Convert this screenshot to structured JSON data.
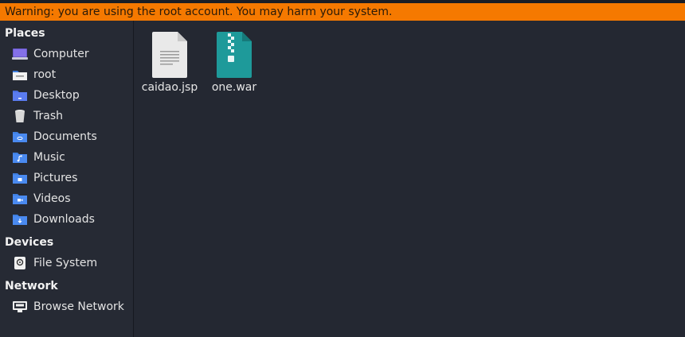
{
  "warning": "Warning: you are using the root account. You may harm your system.",
  "sidebar": {
    "places_header": "Places",
    "places": [
      {
        "label": "Computer",
        "icon": "computer-icon"
      },
      {
        "label": "root",
        "icon": "home-folder-icon"
      },
      {
        "label": "Desktop",
        "icon": "desktop-folder-icon"
      },
      {
        "label": "Trash",
        "icon": "trash-icon"
      },
      {
        "label": "Documents",
        "icon": "documents-folder-icon"
      },
      {
        "label": "Music",
        "icon": "music-folder-icon"
      },
      {
        "label": "Pictures",
        "icon": "pictures-folder-icon"
      },
      {
        "label": "Videos",
        "icon": "videos-folder-icon"
      },
      {
        "label": "Downloads",
        "icon": "downloads-folder-icon"
      }
    ],
    "devices_header": "Devices",
    "devices": [
      {
        "label": "File System",
        "icon": "drive-icon"
      }
    ],
    "network_header": "Network",
    "network": [
      {
        "label": "Browse Network",
        "icon": "network-icon"
      }
    ]
  },
  "files": [
    {
      "name": "caidao.jsp",
      "icon": "text-file-icon"
    },
    {
      "name": "one.war",
      "icon": "archive-file-icon"
    }
  ],
  "colors": {
    "warning_bg": "#f57900",
    "folder_blue": "#3f7fe0",
    "archive_teal": "#1e9a9a",
    "background": "#242832"
  }
}
